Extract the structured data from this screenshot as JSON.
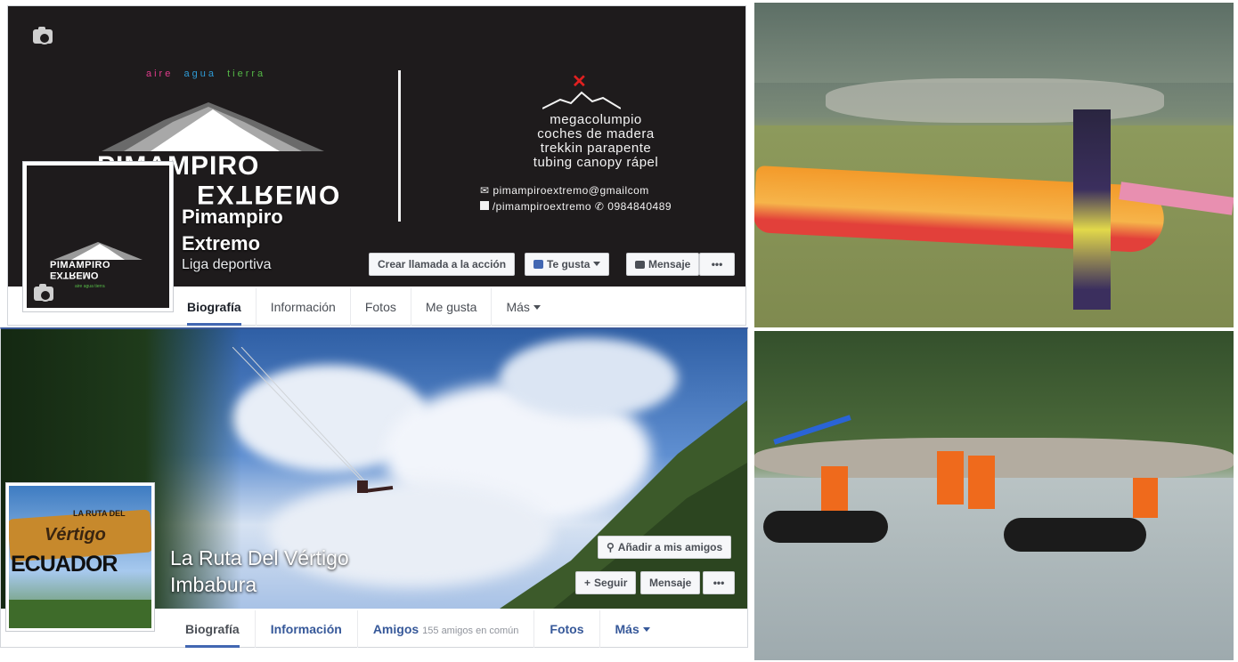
{
  "page1": {
    "cover": {
      "tagline": [
        "aire",
        "agua",
        "tierra"
      ],
      "brand_top": "PIMAMPIRO",
      "brand_bottom": "EXTREMO",
      "services": [
        "megacolumpio",
        "coches de madera",
        "trekkin parapente",
        "tubing canopy rápel"
      ],
      "email": "pimampiroextremo@gmailcom",
      "social": "/pimampiroextremo",
      "phone": "0984840489"
    },
    "avatar": {
      "brand_top": "PIMAMPIRO",
      "brand_bottom": "EXTREMO",
      "tagline": "aire agua tierra"
    },
    "name_line1": "Pimampiro",
    "name_line2": "Extremo",
    "category": "Liga deportiva",
    "buttons": {
      "call": "Crear llamada a la acción",
      "like": "Te gusta",
      "message": "Mensaje",
      "more": "•••"
    },
    "tabs": [
      "Biografía",
      "Información",
      "Fotos",
      "Me gusta",
      "Más"
    ]
  },
  "page2": {
    "avatar": {
      "line1": "LA RUTA DEL",
      "line2": "Vértigo",
      "line3": "ECUADOR"
    },
    "name_line1": "La Ruta Del Vértigo",
    "name_line2": "Imbabura",
    "buttons": {
      "add_friend": "Añadir a mis amigos",
      "follow": "Seguir",
      "message": "Mensaje",
      "more": "•••"
    },
    "tabs": {
      "bio": "Biografía",
      "info": "Información",
      "friends": "Amigos",
      "mutual": "155 amigos en común",
      "photos": "Fotos",
      "more": "Más"
    }
  },
  "icons": [
    "camera-icon",
    "like-thumb-icon",
    "message-icon",
    "person-add-icon",
    "plus-icon",
    "envelope-icon",
    "facebook-icon",
    "phone-icon"
  ],
  "colors": {
    "fb_blue": "#4267b2",
    "link_blue": "#365899",
    "cover_dark": "#1e1b1c",
    "accent_red": "#e02020"
  }
}
